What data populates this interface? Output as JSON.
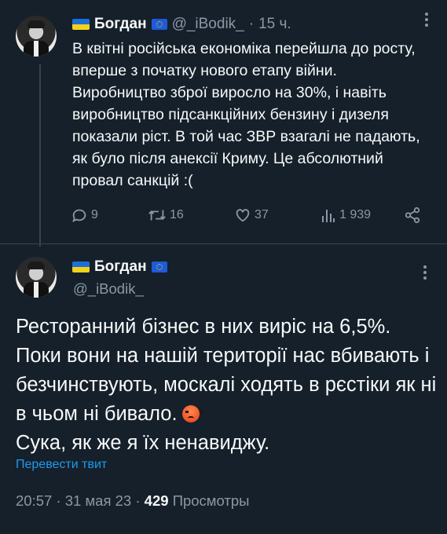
{
  "tweet1": {
    "display_name": "Богдан",
    "handle": "@_iBodik_",
    "separator": "·",
    "time_ago": "15 ч.",
    "text": "В квітні російська економіка перейшла до росту, вперше з початку нового етапу війни. Виробництво зброї виросло на 30%, і навіть виробництво підсанкційних бензину і дизеля показали ріст. В той час ЗВР взагалі не падають, як було після анексії Криму. Це абсолютний провал санкцій :(",
    "replies": "9",
    "retweets": "16",
    "likes": "37",
    "views": "1 939"
  },
  "tweet2": {
    "display_name": "Богдан",
    "handle": "@_iBodik_",
    "text": "Ресторанний бізнес в них виріс на 6,5%. Поки вони на нашій території нас вбивають і безчинствують, москалі ходять в рєстіки як ні в чьом ні бивало.",
    "text_line2": "Сука, як же я їх ненавиджу.",
    "translate_label": "Перевести твит",
    "time": "20:57",
    "separator": "·",
    "date": "31 мая 23",
    "views_count": "429",
    "views_label": "Просмотры"
  },
  "icons": {
    "flag_ua": "ukraine-flag-icon",
    "flag_eu": "eu-flag-icon",
    "more": "more-icon",
    "reply": "reply-icon",
    "retweet": "retweet-icon",
    "like": "heart-icon",
    "views": "views-icon",
    "share": "share-icon",
    "angry": "angry-face-emoji"
  },
  "colors": {
    "background": "#15202b",
    "text": "#f7f9f9",
    "muted": "#8b98a5",
    "link": "#1d9bf0",
    "divider": "#38444d"
  }
}
